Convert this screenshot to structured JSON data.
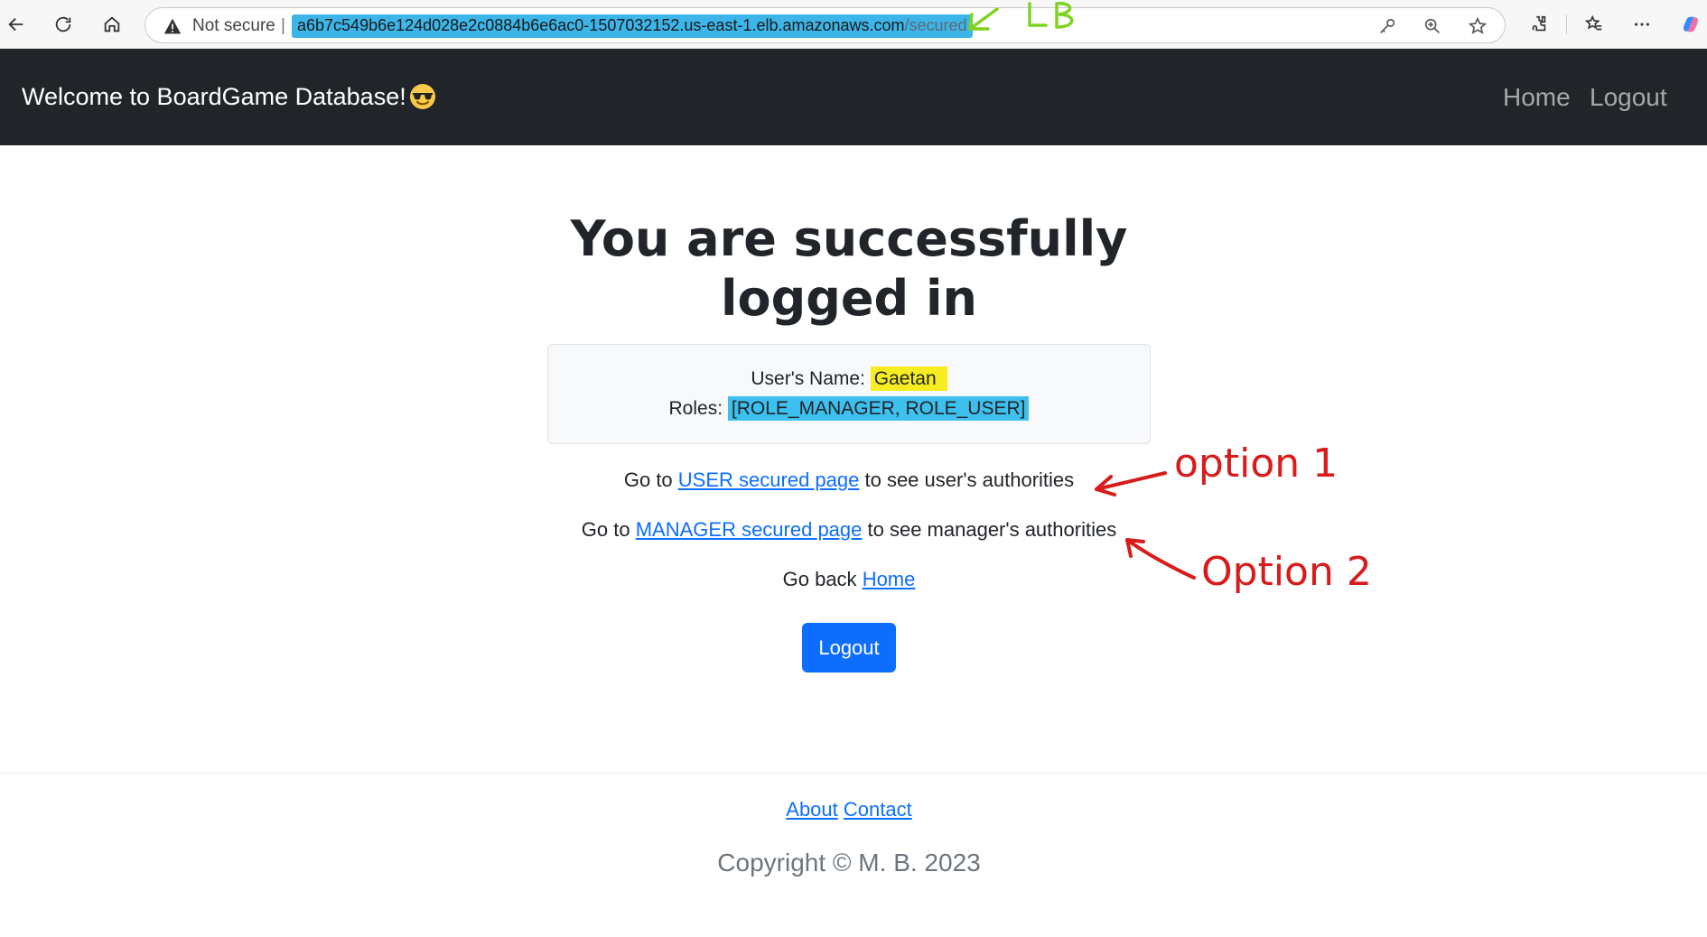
{
  "browser": {
    "not_secure": "Not secure",
    "url_host": "a6b7c549b6e124d028e2c0884b6e6ac0-1507032152.us-east-1.elb.amazonaws.com",
    "url_path": "/secured",
    "annotation_lb": "LB"
  },
  "navbar": {
    "brand": "Welcome to BoardGame Database!",
    "links": [
      "Home",
      "Logout"
    ]
  },
  "main": {
    "title": "You are successfully logged in",
    "user_label": "User's Name:",
    "user_name": "Gaetan",
    "roles_label": "Roles:",
    "roles_value": "[ROLE_MANAGER, ROLE_USER]",
    "user_page": {
      "prefix": "Go to",
      "link": "USER secured page",
      "suffix": "to see user's authorities"
    },
    "manager_page": {
      "prefix": "Go to",
      "link": "MANAGER secured page",
      "suffix": "to see manager's authorities"
    },
    "go_back": {
      "prefix": "Go back",
      "link": "Home"
    },
    "logout_button": "Logout"
  },
  "footer": {
    "links": [
      "About",
      "Contact"
    ],
    "copyright": "Copyright © M. B. 2023"
  },
  "annotations": {
    "option1": "option 1",
    "option2": "Option 2"
  },
  "colors": {
    "navbar_bg": "#212529",
    "primary": "#0d6efd",
    "highlight_yellow": "#f7ec20",
    "highlight_blue": "#3ec0ee",
    "annotation_red": "#d81b1b",
    "annotation_green": "#7ed321"
  }
}
